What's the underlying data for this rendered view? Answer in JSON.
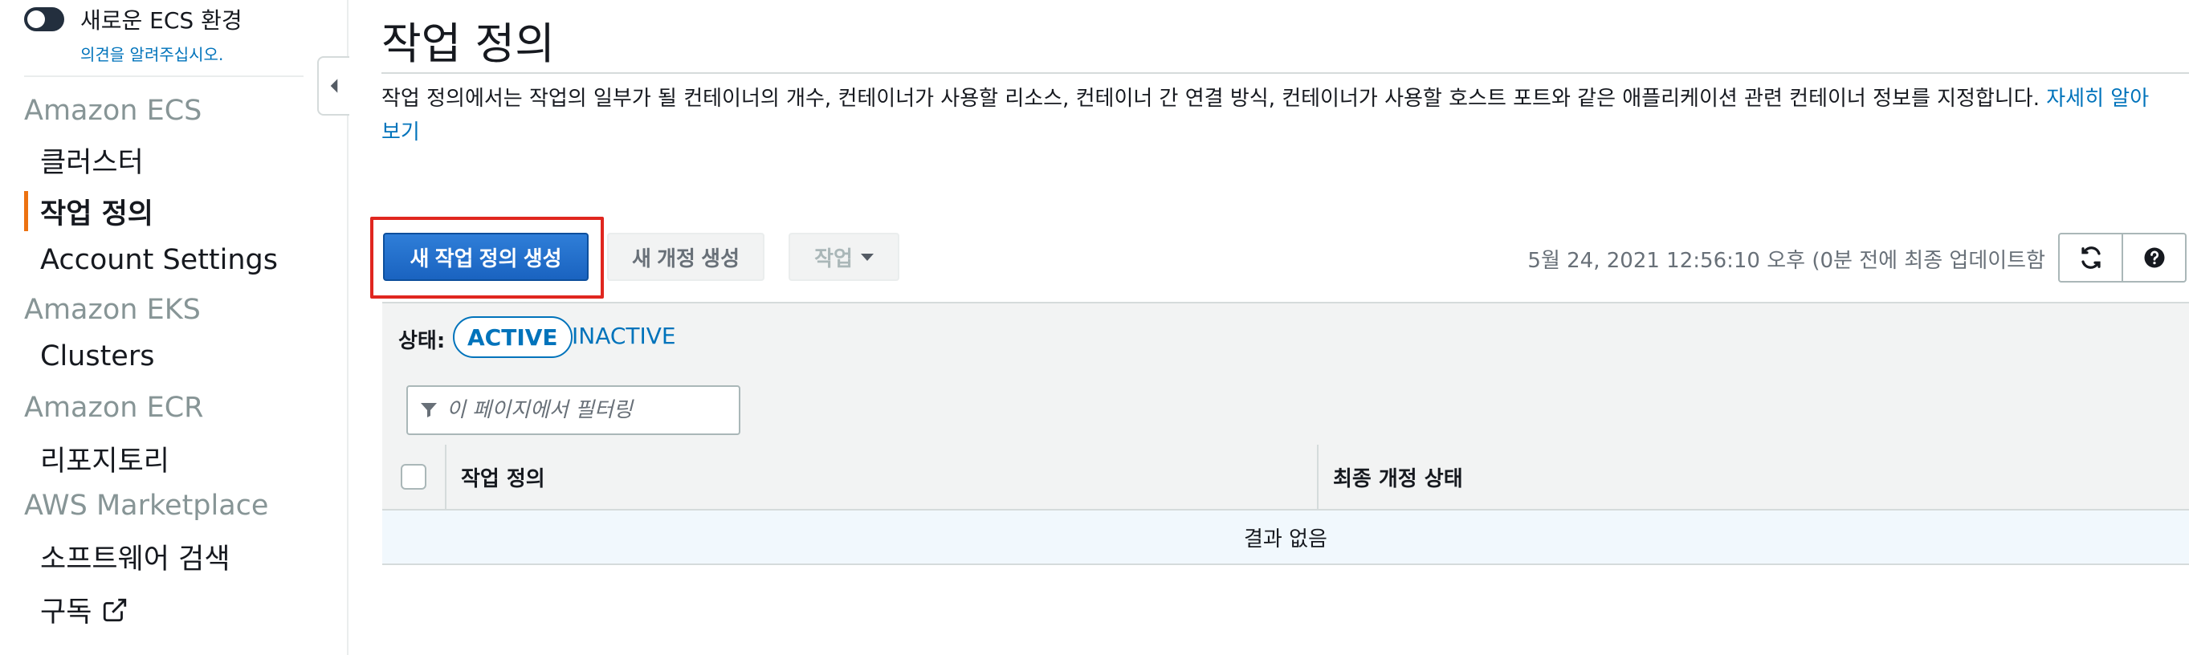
{
  "sidebar": {
    "toggle_label": "새로운 ECS 환경",
    "feedback_link": "의견을 알려주십시오.",
    "sections": [
      {
        "title": "Amazon ECS",
        "items": [
          "클러스터",
          "작업 정의",
          "Account Settings"
        ]
      },
      {
        "title": "Amazon EKS",
        "items": [
          "Clusters"
        ]
      },
      {
        "title": "Amazon ECR",
        "items": [
          "리포지토리"
        ]
      },
      {
        "title": "AWS Marketplace",
        "items": [
          "소프트웨어 검색",
          "구독"
        ]
      }
    ],
    "active_item": "작업 정의"
  },
  "page": {
    "title": "작업 정의",
    "description": "작업 정의에서는 작업의 일부가 될 컨테이너의 개수, 컨테이너가 사용할 리소스, 컨테이너 간 연결 방식, 컨테이너가 사용할 호스트 포트와 같은 애플리케이션 관련 컨테이너 정보를 지정합니다.",
    "learn_more": "자세히 알아보기"
  },
  "toolbar": {
    "create_label": "새 작업 정의 생성",
    "new_revision_label": "새 개정 생성",
    "actions_label": "작업",
    "timestamp": "5월 24, 2021 12:56:10 오후 (0분 전에 최종 업데이트함"
  },
  "status_filter": {
    "label": "상태:",
    "active": "ACTIVE",
    "inactive": "INACTIVE"
  },
  "filter": {
    "placeholder": "이 페이지에서 필터링"
  },
  "table": {
    "columns": [
      "작업 정의",
      "최종 개정 상태"
    ],
    "empty_message": "결과 없음"
  },
  "colors": {
    "primary": "#1a63c0",
    "link": "#0073bb",
    "active_indicator": "#ec7211",
    "highlight": "#e0261f"
  }
}
